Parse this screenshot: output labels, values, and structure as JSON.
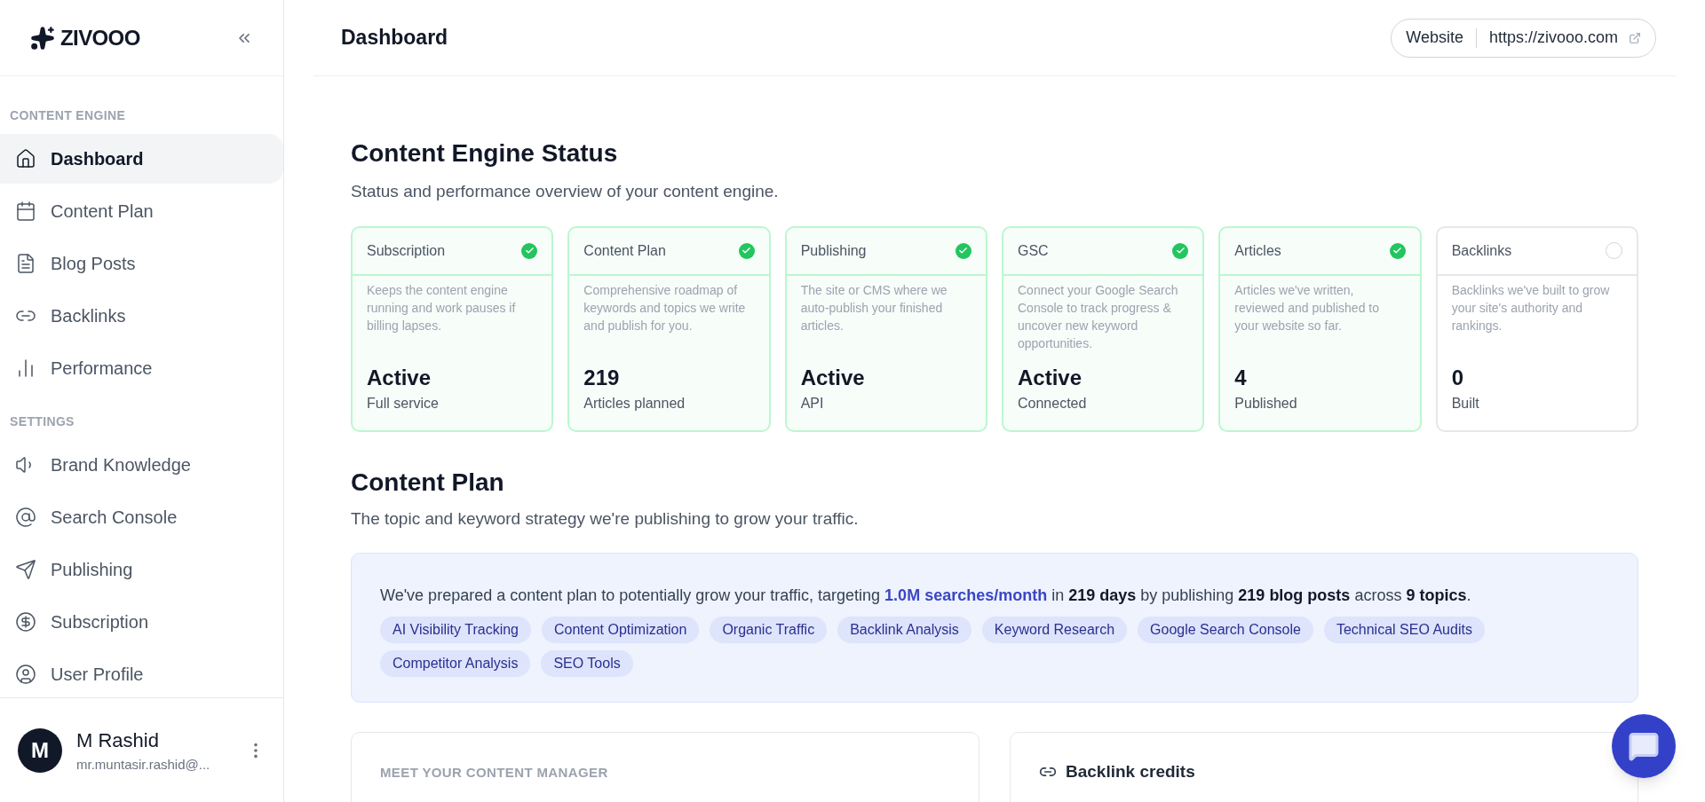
{
  "brand": {
    "name": "ZIVOOO"
  },
  "sidebar": {
    "sections": [
      {
        "title": "CONTENT ENGINE",
        "items": [
          {
            "label": "Dashboard",
            "kind": "home",
            "selected": true
          },
          {
            "label": "Content Plan",
            "kind": "calendar",
            "selected": false
          },
          {
            "label": "Blog Posts",
            "kind": "file",
            "selected": false
          },
          {
            "label": "Backlinks",
            "kind": "link",
            "selected": false
          },
          {
            "label": "Performance",
            "kind": "chart",
            "selected": false
          }
        ]
      },
      {
        "title": "SETTINGS",
        "items": [
          {
            "label": "Brand Knowledge",
            "kind": "speaker",
            "selected": false
          },
          {
            "label": "Search Console",
            "kind": "search",
            "selected": false
          },
          {
            "label": "Publishing",
            "kind": "send",
            "selected": false
          },
          {
            "label": "Subscription",
            "kind": "dollar",
            "selected": false
          },
          {
            "label": "User Profile",
            "kind": "user",
            "selected": false
          }
        ]
      }
    ],
    "user": {
      "initial": "M",
      "name": "M Rashid",
      "email": "mr.muntasir.rashid@..."
    }
  },
  "header": {
    "title": "Dashboard",
    "website_label": "Website",
    "website_url": "https://zivooo.com"
  },
  "status": {
    "title": "Content Engine Status",
    "subtitle": "Status and performance overview of your content engine.",
    "cards": [
      {
        "title": "Subscription",
        "done": true,
        "description": "Keeps the content engine running and work pauses if billing lapses.",
        "value": "Active",
        "caption": "Full service"
      },
      {
        "title": "Content Plan",
        "done": true,
        "description": "Comprehensive roadmap of keywords and topics we write and publish for you.",
        "value": "219",
        "caption": "Articles planned"
      },
      {
        "title": "Publishing",
        "done": true,
        "description": "The site or CMS where we auto-publish your finished articles.",
        "value": "Active",
        "caption": "API"
      },
      {
        "title": "GSC",
        "done": true,
        "description": "Connect your Google Search Console to track progress & uncover new keyword opportunities.",
        "value": "Active",
        "caption": "Connected"
      },
      {
        "title": "Articles",
        "done": true,
        "description": "Articles we've written, reviewed and published to your website so far.",
        "value": "4",
        "caption": "Published"
      },
      {
        "title": "Backlinks",
        "done": false,
        "description": "Backlinks we've built to grow your site's authority and rankings.",
        "value": "0",
        "caption": "Built"
      }
    ]
  },
  "content_plan": {
    "title": "Content Plan",
    "subtitle": "The topic and keyword strategy we're publishing to grow your traffic.",
    "summary": [
      {
        "kind": "plain",
        "text": "We've prepared a content plan to potentially grow your traffic, targeting "
      },
      {
        "kind": "highlight",
        "text": "1.0M searches/month"
      },
      {
        "kind": "plain",
        "text": " in "
      },
      {
        "kind": "bold",
        "text": "219 days"
      },
      {
        "kind": "plain",
        "text": " by publishing "
      },
      {
        "kind": "bold",
        "text": "219 blog posts"
      },
      {
        "kind": "plain",
        "text": " across "
      },
      {
        "kind": "bold",
        "text": "9 topics"
      },
      {
        "kind": "plain",
        "text": "."
      }
    ],
    "topics": [
      "AI Visibility Tracking",
      "Content Optimization",
      "Organic Traffic",
      "Backlink Analysis",
      "Keyword Research",
      "Google Search Console",
      "Technical SEO Audits",
      "Competitor Analysis",
      "SEO Tools"
    ]
  },
  "manager_card": {
    "title": "MEET YOUR CONTENT MANAGER"
  },
  "credits_card": {
    "title": "Backlink credits"
  }
}
